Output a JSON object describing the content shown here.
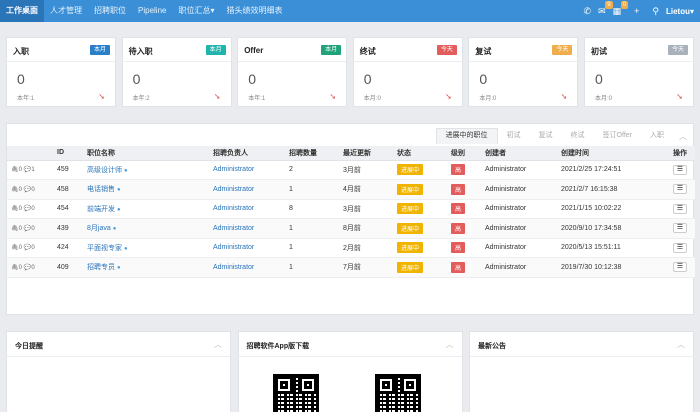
{
  "nav": {
    "items": [
      "工作桌面",
      "人才管理",
      "招聘职位",
      "Pipeline",
      "职位汇总▾",
      "猎头绩效明细表"
    ],
    "user": "Lietou▾",
    "badges": {
      "mail": "9",
      "calendar": "0"
    }
  },
  "stats": [
    {
      "title": "入职",
      "tag": "本月",
      "tag_color": "#2a7fc9",
      "value": "0",
      "sub": "本年:1"
    },
    {
      "title": "待入职",
      "tag": "本月",
      "tag_color": "#1fb5ad",
      "value": "0",
      "sub": "本年:2"
    },
    {
      "title": "Offer",
      "tag": "本月",
      "tag_color": "#1fa37a",
      "value": "0",
      "sub": "本年:1"
    },
    {
      "title": "终试",
      "tag": "今天",
      "tag_color": "#e25c5c",
      "value": "0",
      "sub": "本月:0"
    },
    {
      "title": "复试",
      "tag": "今天",
      "tag_color": "#f0ad4e",
      "value": "0",
      "sub": "本月:0"
    },
    {
      "title": "初试",
      "tag": "今天",
      "tag_color": "#a9b1bb",
      "value": "0",
      "sub": "本月:0"
    }
  ],
  "jobs": {
    "tabs": [
      "进展中的职位",
      "初试",
      "复试",
      "终试",
      "签订Offer",
      "入职"
    ],
    "columns": [
      "",
      "ID",
      "职位名称",
      "招聘负责人",
      "招聘数量",
      "最近更新",
      "状态",
      "级别",
      "创建者",
      "创建时间",
      "操作"
    ],
    "rows": [
      {
        "files": "0",
        "comments": "1",
        "id": "459",
        "title": "高级设计师",
        "owner": "Administrator",
        "count": "2",
        "updated": "3月前",
        "status": "进展中",
        "level": "高",
        "creator": "Administrator",
        "created": "2021/2/25 17:24:51"
      },
      {
        "files": "0",
        "comments": "0",
        "id": "458",
        "title": "电话销售",
        "owner": "Administrator",
        "count": "1",
        "updated": "4月前",
        "status": "进展中",
        "level": "高",
        "creator": "Administrator",
        "created": "2021/2/7 16:15:38"
      },
      {
        "files": "0",
        "comments": "0",
        "id": "454",
        "title": "前端开发",
        "owner": "Administrator",
        "count": "8",
        "updated": "3月前",
        "status": "进展中",
        "level": "高",
        "creator": "Administrator",
        "created": "2021/1/15 10:02:22"
      },
      {
        "files": "0",
        "comments": "0",
        "id": "439",
        "title": "8月java",
        "owner": "Administrator",
        "count": "1",
        "updated": "8月前",
        "status": "进展中",
        "level": "高",
        "creator": "Administrator",
        "created": "2020/9/10 17:34:58"
      },
      {
        "files": "0",
        "comments": "0",
        "id": "424",
        "title": "平面视专家",
        "owner": "Administrator",
        "count": "1",
        "updated": "2月前",
        "status": "进展中",
        "level": "高",
        "creator": "Administrator",
        "created": "2020/5/13 15:51:11"
      },
      {
        "files": "0",
        "comments": "0",
        "id": "409",
        "title": "招聘专员",
        "owner": "Administrator",
        "count": "1",
        "updated": "7月前",
        "status": "进展中",
        "level": "高",
        "creator": "Administrator",
        "created": "2019/7/30 10:12:38"
      }
    ]
  },
  "bottom": {
    "reminder": "今日提醒",
    "app": "招聘软件App版下载",
    "notice": "最新公告"
  }
}
